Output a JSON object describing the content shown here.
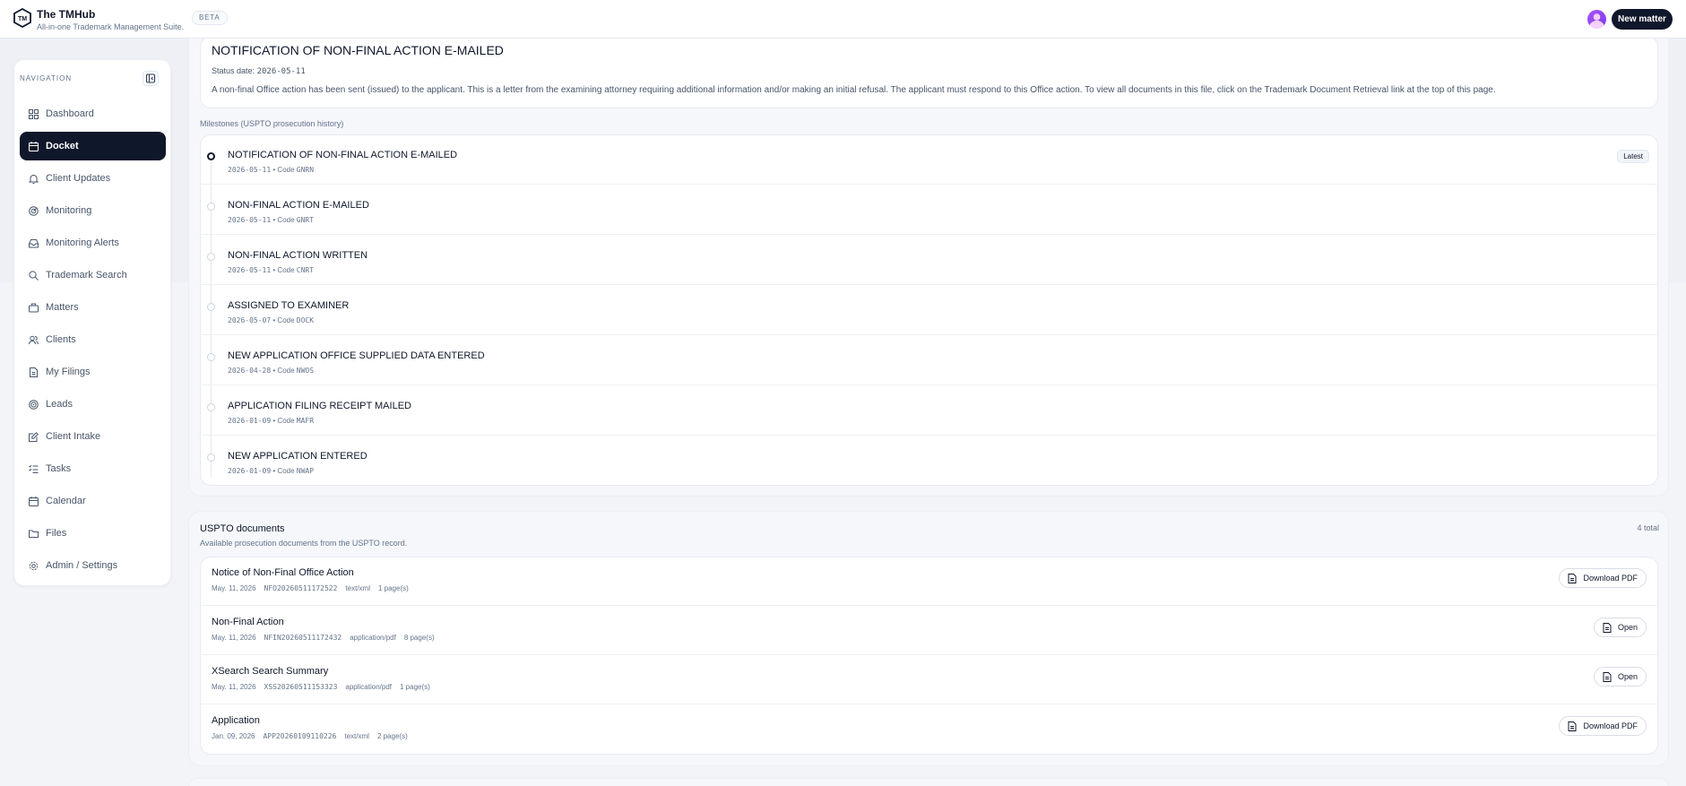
{
  "app": {
    "title": "The TMHub",
    "subtitle": "All-in-one Trademark Management Suite.",
    "badge": "BETA",
    "new_matter_label": "New matter",
    "logo_text": "TM"
  },
  "sidebar": {
    "heading": "NAVIGATION",
    "items": [
      {
        "label": "Dashboard",
        "icon": "dashboard-icon"
      },
      {
        "label": "Docket",
        "icon": "calendar-icon",
        "active": true
      },
      {
        "label": "Client Updates",
        "icon": "bell-icon"
      },
      {
        "label": "Monitoring",
        "icon": "radar-icon"
      },
      {
        "label": "Monitoring Alerts",
        "icon": "inbox-icon"
      },
      {
        "label": "Trademark Search",
        "icon": "search-icon"
      },
      {
        "label": "Matters",
        "icon": "briefcase-icon"
      },
      {
        "label": "Clients",
        "icon": "users-icon"
      },
      {
        "label": "My Filings",
        "icon": "file-icon"
      },
      {
        "label": "Leads",
        "icon": "target-icon"
      },
      {
        "label": "Client Intake",
        "icon": "edit-icon"
      },
      {
        "label": "Tasks",
        "icon": "list-check-icon"
      },
      {
        "label": "Calendar",
        "icon": "calendar-icon"
      },
      {
        "label": "Files",
        "icon": "folder-icon"
      },
      {
        "label": "Admin / Settings",
        "icon": "gear-icon"
      }
    ]
  },
  "status": {
    "title": "NOTIFICATION OF NON-FINAL ACTION E-MAILED",
    "date_label": "Status date:",
    "date": "2026-05-11",
    "description": "A non-final Office action has been sent (issued) to the applicant. This is a letter from the examining attorney requiring additional information and/or making an initial refusal. The applicant must respond to this Office action. To view all documents in this file, click on the Trademark Document Retrieval link at the top of this page."
  },
  "milestones": {
    "heading": "Milestones (USPTO prosecution history)",
    "latest_label": "Latest",
    "code_prefix": "• Code",
    "items": [
      {
        "title": "NOTIFICATION OF NON-FINAL ACTION E-MAILED",
        "date": "2026-05-11",
        "code": "GNRN"
      },
      {
        "title": "NON-FINAL ACTION E-MAILED",
        "date": "2026-05-11",
        "code": "GNRT"
      },
      {
        "title": "NON-FINAL ACTION WRITTEN",
        "date": "2026-05-11",
        "code": "CNRT"
      },
      {
        "title": "ASSIGNED TO EXAMINER",
        "date": "2026-05-07",
        "code": "DOCK"
      },
      {
        "title": "NEW APPLICATION OFFICE SUPPLIED DATA ENTERED",
        "date": "2026-04-28",
        "code": "NWOS"
      },
      {
        "title": "APPLICATION FILING RECEIPT MAILED",
        "date": "2026-01-09",
        "code": "MAFR"
      },
      {
        "title": "NEW APPLICATION ENTERED",
        "date": "2026-01-09",
        "code": "NWAP"
      }
    ]
  },
  "documents": {
    "title": "USPTO documents",
    "subtitle": "Available prosecution documents from the USPTO record.",
    "count": "4 total",
    "items": [
      {
        "title": "Notice of Non-Final Office Action",
        "date": "May. 11, 2026",
        "id": "NFO20260511172522",
        "type": "text/xml",
        "pages": "1 page(s)",
        "action": "Download PDF"
      },
      {
        "title": "Non-Final Action",
        "date": "May. 11, 2026",
        "id": "NFIN20260511172432",
        "type": "application/pdf",
        "pages": "8 page(s)",
        "action": "Open"
      },
      {
        "title": "XSearch Search Summary",
        "date": "May. 11, 2026",
        "id": "XSS20260511153323",
        "type": "application/pdf",
        "pages": "1 page(s)",
        "action": "Open"
      },
      {
        "title": "Application",
        "date": "Jan. 09, 2026",
        "id": "APP20260109110226",
        "type": "text/xml",
        "pages": "2 page(s)",
        "action": "Download PDF"
      }
    ]
  }
}
